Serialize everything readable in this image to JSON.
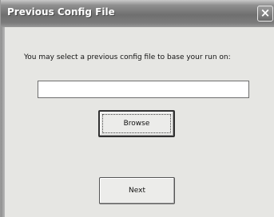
{
  "window": {
    "title": "Previous Config File",
    "close_glyph": "×"
  },
  "dialog": {
    "prompt": "You may select a previous config file to base your run on:",
    "path_value": "",
    "browse_label": "Browse",
    "next_label": "Next"
  },
  "colors": {
    "titlebar": "#7c7c7c",
    "dialog_background": "#e6e6e3",
    "input_background": "#ffffff"
  }
}
